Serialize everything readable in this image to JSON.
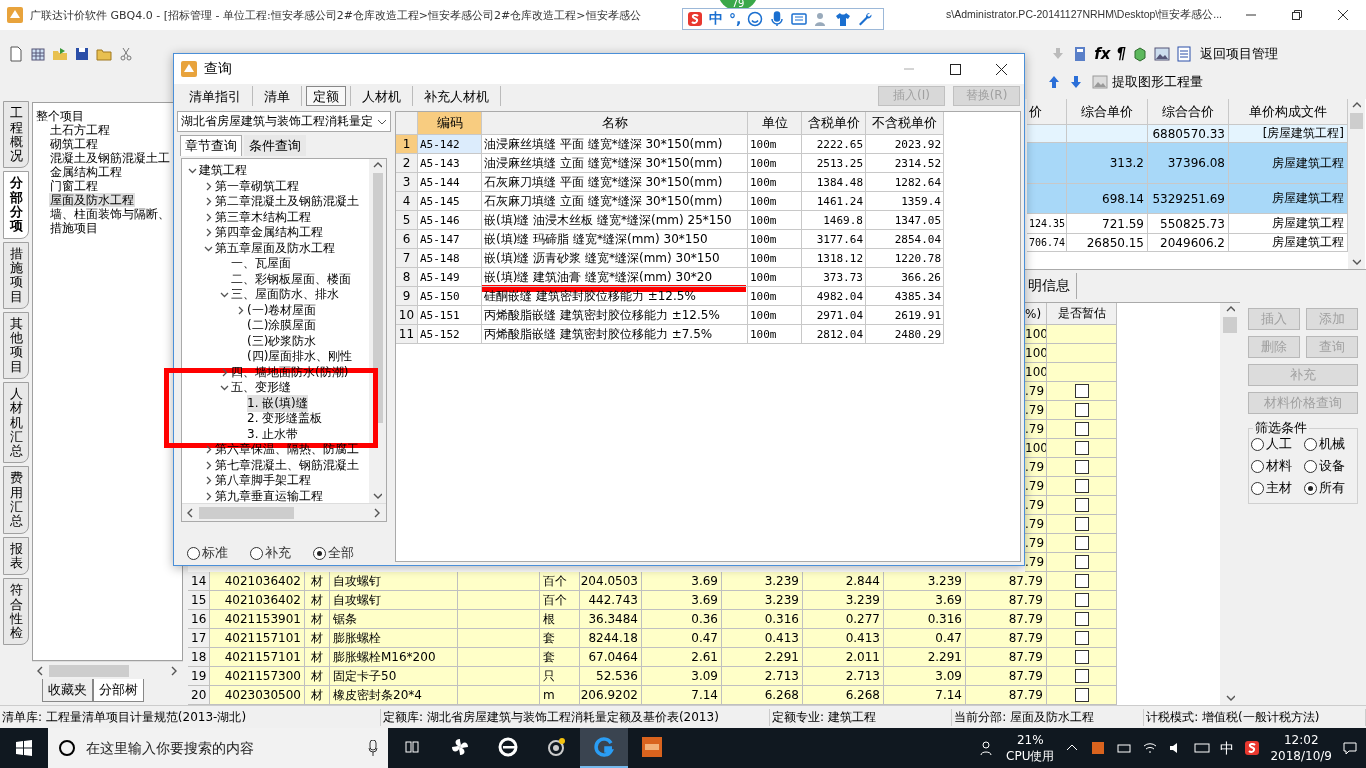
{
  "window": {
    "title_left": "广联达计价软件 GBQ4.0 - [招标管理 - 单位工程:恒安孝感公司2#仓库改造工程>恒安孝感公司2#仓库改造工程>恒安孝感公",
    "title_right": "s\\Administrator.PC-20141127NRHM\\Desktop\\恒安孝感公..."
  },
  "ime_bar": {
    "badge": "79",
    "mode": "中",
    "punct": "°,"
  },
  "toolbar": {
    "formula_glyph": "fx",
    "para_glyph": "¶",
    "back_label": "返回项目管理",
    "extract_label": "提取图形工程量"
  },
  "side_tabs": [
    {
      "label": "工程概况",
      "selected": false
    },
    {
      "label": "分部分项",
      "selected": true
    },
    {
      "label": "措施项目",
      "selected": false
    },
    {
      "label": "其他项目",
      "selected": false
    },
    {
      "label": "人材机汇总",
      "selected": false
    },
    {
      "label": "费用汇总",
      "selected": false
    },
    {
      "label": "报表",
      "selected": false
    },
    {
      "label": "符合性检",
      "selected": false
    }
  ],
  "project_tree": {
    "root": "整个项目",
    "children": [
      {
        "label": "土石方工程",
        "selected": false
      },
      {
        "label": "砌筑工程",
        "selected": false
      },
      {
        "label": "混凝土及钢筋混凝土工",
        "selected": false
      },
      {
        "label": "金属结构工程",
        "selected": false
      },
      {
        "label": "门窗工程",
        "selected": false
      },
      {
        "label": "屋面及防水工程",
        "selected": true
      },
      {
        "label": "墙、柱面装饰与隔断、",
        "selected": false
      },
      {
        "label": "措施项目",
        "selected": false
      }
    ]
  },
  "tree_tabs": [
    {
      "label": "收藏夹",
      "selected": false
    },
    {
      "label": "分部树",
      "selected": true
    }
  ],
  "upper_table": {
    "columns": [
      "价",
      "综合单价",
      "综合合价",
      "单价构成文件"
    ],
    "rows": [
      {
        "kind": "section",
        "selected": false,
        "total": "6880570.33",
        "file": "[房屋建筑工程]"
      },
      {
        "kind": "item",
        "selected": true,
        "unit_price": "313.2",
        "total": "37396.08",
        "file": "房屋建筑工程"
      },
      {
        "kind": "item",
        "selected": true,
        "unit_price": "698.14",
        "total": "5329251.69",
        "file": "房屋建筑工程"
      },
      {
        "kind": "item",
        "selected": false,
        "column_1": "124.35",
        "unit_price": "721.59",
        "total": "550825.73",
        "file": "房屋建筑工程"
      },
      {
        "kind": "item",
        "selected": false,
        "column_1": "706.74",
        "unit_price": "26850.15",
        "total": "2049606.2",
        "file": "房屋建筑工程"
      }
    ]
  },
  "lower_tab": "明信息",
  "lower_table": {
    "columns": [
      "%)",
      "是否暂估"
    ],
    "tail_rows": [
      {
        "rate": "100"
      },
      {
        "rate": "100"
      },
      {
        "rate": "100"
      },
      {
        "rate": ".79",
        "checked": false
      },
      {
        "rate": ".79",
        "checked": false
      },
      {
        "rate": ".79",
        "checked": false
      },
      {
        "rate": "100",
        "checked": false
      },
      {
        "rate": ".79",
        "checked": false
      },
      {
        "rate": ".79",
        "checked": false
      },
      {
        "rate": ".79",
        "checked": false
      },
      {
        "rate": ".79",
        "checked": false
      },
      {
        "rate": ".79",
        "checked": false
      },
      {
        "rate": ".79",
        "checked": false
      }
    ],
    "rows": [
      {
        "no": "14",
        "code": "4021036402",
        "type": "材",
        "name": "自攻螺钉",
        "unit": "百个",
        "qty": "204.0503",
        "price_1": "3.69",
        "price_2": "3.239",
        "price_3": "2.844",
        "price_4": "3.239",
        "rate": "87.79",
        "checked": false
      },
      {
        "no": "15",
        "code": "4021036402",
        "type": "材",
        "name": "自攻螺钉",
        "unit": "百个",
        "qty": "442.743",
        "price_1": "3.69",
        "price_2": "3.239",
        "price_3": "3.239",
        "price_4": "3.69",
        "rate": "87.79",
        "checked": false
      },
      {
        "no": "16",
        "code": "4021153901",
        "type": "材",
        "name": "锯条",
        "unit": "根",
        "qty": "36.3484",
        "price_1": "0.36",
        "price_2": "0.316",
        "price_3": "0.277",
        "price_4": "0.316",
        "rate": "87.79",
        "checked": false
      },
      {
        "no": "17",
        "code": "4021157101",
        "type": "材",
        "name": "膨胀螺栓",
        "unit": "套",
        "qty": "8244.18",
        "price_1": "0.47",
        "price_2": "0.413",
        "price_3": "0.413",
        "price_4": "0.47",
        "rate": "87.79",
        "checked": false
      },
      {
        "no": "18",
        "code": "4021157101",
        "type": "材",
        "name": "膨胀螺栓M16*200",
        "unit": "套",
        "qty": "67.0464",
        "price_1": "2.61",
        "price_2": "2.291",
        "price_3": "2.011",
        "price_4": "2.291",
        "rate": "87.79",
        "checked": false
      },
      {
        "no": "19",
        "code": "4021157300",
        "type": "材",
        "name": "固定卡子50",
        "unit": "只",
        "qty": "52.536",
        "price_1": "3.09",
        "price_2": "2.713",
        "price_3": "2.713",
        "price_4": "3.09",
        "rate": "87.79",
        "checked": false
      },
      {
        "no": "20",
        "code": "4023030500",
        "type": "材",
        "name": "橡皮密封条20*4",
        "unit": "m",
        "qty": "206.9202",
        "price_1": "7.14",
        "price_2": "6.268",
        "price_3": "6.268",
        "price_4": "7.14",
        "rate": "87.79",
        "checked": false
      }
    ]
  },
  "side_buttons": [
    {
      "label": "插入",
      "disabled": true
    },
    {
      "label": "添加",
      "disabled": true
    },
    {
      "label": "删除",
      "disabled": true
    },
    {
      "label": "查询",
      "disabled": true
    },
    {
      "label": "补充",
      "disabled": true
    },
    {
      "label": "材料价格查询",
      "disabled": true
    }
  ],
  "filter": {
    "title": "筛选条件",
    "options": [
      {
        "label": "人工",
        "selected": false
      },
      {
        "label": "机械",
        "selected": false
      },
      {
        "label": "材料",
        "selected": false
      },
      {
        "label": "设备",
        "selected": false
      },
      {
        "label": "主材",
        "selected": false
      },
      {
        "label": "所有",
        "selected": true
      }
    ]
  },
  "dialog": {
    "title": "查询",
    "tabs": [
      {
        "label": "清单指引",
        "selected": false
      },
      {
        "label": "清单",
        "selected": false
      },
      {
        "label": "定额",
        "selected": true
      },
      {
        "label": "人材机",
        "selected": false
      },
      {
        "label": "补充人材机",
        "selected": false
      }
    ],
    "actions": [
      {
        "label": "插入(I)",
        "disabled": true
      },
      {
        "label": "替换(R)",
        "disabled": true
      }
    ],
    "library": "湖北省房屋建筑与装饰工程消耗量定",
    "search_tabs": [
      {
        "label": "章节查询",
        "selected": true
      },
      {
        "label": "条件查询",
        "selected": false
      }
    ],
    "tree": [
      {
        "label": "建筑工程",
        "expanded": true,
        "selected": false,
        "children": [
          {
            "label": "第一章砌筑工程",
            "expanded": false,
            "selected": false
          },
          {
            "label": "第二章混凝土及钢筋混凝土",
            "expanded": false,
            "selected": false
          },
          {
            "label": "第三章木结构工程",
            "expanded": false,
            "selected": false
          },
          {
            "label": "第四章金属结构工程",
            "expanded": false,
            "selected": false
          },
          {
            "label": "第五章屋面及防水工程",
            "expanded": true,
            "selected": false,
            "children": [
              {
                "label": "一、瓦屋面",
                "selected": false
              },
              {
                "label": "二、彩钢板屋面、楼面",
                "selected": false
              },
              {
                "label": "三、屋面防水、排水",
                "expanded": true,
                "selected": false,
                "children": [
                  {
                    "label": "(一)卷材屋面",
                    "expanded": false,
                    "selected": false
                  },
                  {
                    "label": "(二)涂膜屋面",
                    "selected": false
                  },
                  {
                    "label": "(三)砂浆防水",
                    "selected": false
                  },
                  {
                    "label": "(四)屋面排水、刚性",
                    "selected": false
                  }
                ]
              },
              {
                "label": "四、墙地面防水(防潮)",
                "expanded": false,
                "selected": false
              },
              {
                "label": "五、变形缝",
                "expanded": true,
                "selected": false,
                "children": [
                  {
                    "label": "1. 嵌(填)缝",
                    "selected": true
                  },
                  {
                    "label": "2. 变形缝盖板",
                    "selected": false
                  },
                  {
                    "label": "3. 止水带",
                    "selected": false
                  }
                ]
              }
            ]
          },
          {
            "label": "第六章保温、隔热、防腐工",
            "expanded": false,
            "selected": false
          },
          {
            "label": "第七章混凝土、钢筋混凝土",
            "expanded": false,
            "selected": false
          },
          {
            "label": "第八章脚手架工程",
            "expanded": false,
            "selected": false
          },
          {
            "label": "第九章垂直运输工程",
            "expanded": false,
            "selected": false
          }
        ]
      }
    ],
    "scope": [
      {
        "label": "标准",
        "selected": false
      },
      {
        "label": "补充",
        "selected": false
      },
      {
        "label": "全部",
        "selected": true
      }
    ],
    "table": {
      "columns": [
        "编码",
        "名称",
        "单位",
        "含税单价",
        "不含税单价"
      ],
      "rows": [
        {
          "no": "1",
          "code": "A5-142",
          "name": "油浸麻丝填缝 平面 缝宽*缝深 30*150(mm)",
          "unit": "100m",
          "price_tax": "2222.65",
          "price": "2023.92",
          "selected": true
        },
        {
          "no": "2",
          "code": "A5-143",
          "name": "油浸麻丝填缝 立面 缝宽*缝深 30*150(mm)",
          "unit": "100m",
          "price_tax": "2513.25",
          "price": "2314.52",
          "selected": false
        },
        {
          "no": "3",
          "code": "A5-144",
          "name": "石灰麻刀填缝 平面 缝宽*缝深 30*150(mm)",
          "unit": "100m",
          "price_tax": "1384.48",
          "price": "1282.64",
          "selected": false
        },
        {
          "no": "4",
          "code": "A5-145",
          "name": "石灰麻刀填缝 立面 缝宽*缝深 30*150(mm)",
          "unit": "100m",
          "price_tax": "1461.24",
          "price": "1359.4",
          "selected": false
        },
        {
          "no": "5",
          "code": "A5-146",
          "name": "嵌(填)缝 油浸木丝板 缝宽*缝深(mm) 25*150",
          "unit": "100m",
          "price_tax": "1469.8",
          "price": "1347.05",
          "selected": false
        },
        {
          "no": "6",
          "code": "A5-147",
          "name": "嵌(填)缝 玛碲脂 缝宽*缝深(mm) 30*150",
          "unit": "100m",
          "price_tax": "3177.64",
          "price": "2854.04",
          "selected": false
        },
        {
          "no": "7",
          "code": "A5-148",
          "name": "嵌(填)缝 沥青砂浆 缝宽*缝深(mm) 30*150",
          "unit": "100m",
          "price_tax": "1318.12",
          "price": "1220.78",
          "selected": false
        },
        {
          "no": "8",
          "code": "A5-149",
          "name": "嵌(填)缝 建筑油膏 缝宽*缝深(mm) 30*20",
          "unit": "100m",
          "price_tax": "373.73",
          "price": "366.26",
          "selected": false
        },
        {
          "no": "9",
          "code": "A5-150",
          "name": "硅酮嵌缝 建筑密封胶位移能力 ±12.5%",
          "unit": "100m",
          "price_tax": "4982.04",
          "price": "4385.34",
          "selected": false
        },
        {
          "no": "10",
          "code": "A5-151",
          "name": "丙烯酸脂嵌缝 建筑密封胶位移能力 ±12.5%",
          "unit": "100m",
          "price_tax": "2971.04",
          "price": "2619.91",
          "selected": false
        },
        {
          "no": "11",
          "code": "A5-152",
          "name": "丙烯酸脂嵌缝 建筑密封胶位移能力 ±7.5%",
          "unit": "100m",
          "price_tax": "2812.04",
          "price": "2480.29",
          "selected": false
        }
      ]
    },
    "red_frame": true,
    "red_underline": true
  },
  "status_bar": [
    "清单库: 工程量清单项目计量规范(2013-湖北)",
    "定额库: 湖北省房屋建筑与装饰工程消耗量定额及基价表(2013)",
    "定额专业: 建筑工程",
    "当前分部: 屋面及防水工程",
    "计税模式: 增值税(一般计税方法)"
  ],
  "taskbar": {
    "search_placeholder": "在这里输入你要搜索的内容",
    "apps": [
      {
        "kind": "taskview",
        "active": false
      },
      {
        "kind": "pinwheel",
        "active": false
      },
      {
        "kind": "browser",
        "active": false
      },
      {
        "kind": "swirl",
        "active": false
      },
      {
        "kind": "glodon",
        "active": true
      },
      {
        "kind": "pdf",
        "active": false
      }
    ],
    "cpu_value": "21%",
    "cpu_label": "CPU使用",
    "lang": "中",
    "time": "12:02",
    "date": "2018/10/9"
  }
}
